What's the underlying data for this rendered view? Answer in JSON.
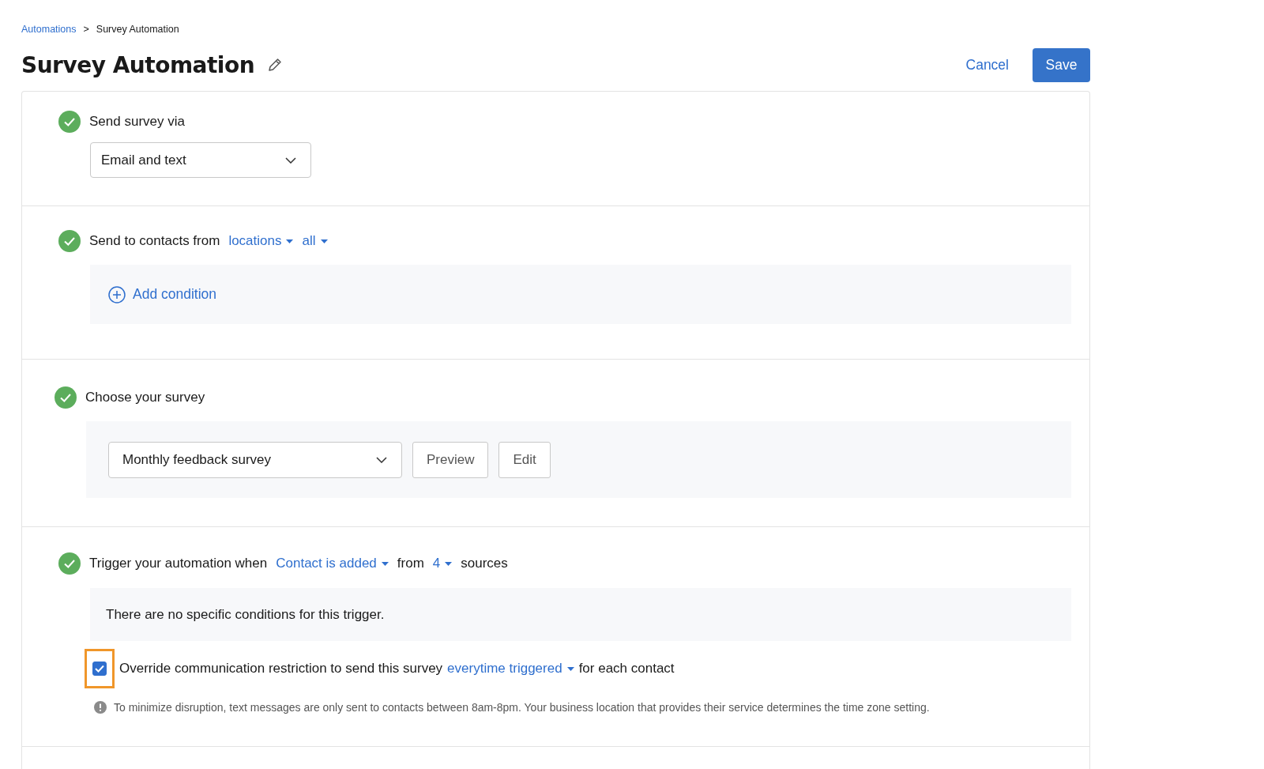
{
  "breadcrumb": [
    {
      "label": "Automations",
      "kind": "link"
    },
    {
      "label": "Survey Automation",
      "kind": "current",
      "separator": ">"
    }
  ],
  "title": "Survey Automation",
  "actions": {
    "cancel": "Cancel",
    "save": "Save"
  },
  "sections": [
    {
      "kind": "select",
      "done": true,
      "header": [
        {
          "kind": "text",
          "text": "Send survey via"
        }
      ],
      "select": {
        "value": "Email and text"
      }
    },
    {
      "kind": "conditions",
      "done": true,
      "header": [
        {
          "kind": "text",
          "text": "Send to contacts from"
        },
        {
          "kind": "dropdown",
          "text": "locations"
        },
        {
          "kind": "dropdown",
          "text": "all"
        }
      ],
      "add_condition": "Add condition"
    },
    {
      "kind": "survey",
      "done": true,
      "header": [
        {
          "kind": "text",
          "text": "Choose your survey"
        }
      ],
      "select": {
        "value": "Monthly feedback survey"
      },
      "buttons": [
        "Preview",
        "Edit"
      ]
    },
    {
      "kind": "trigger",
      "done": true,
      "header": [
        {
          "kind": "text",
          "text": "Trigger your automation when"
        },
        {
          "kind": "dropdown",
          "text": "Contact is added"
        },
        {
          "kind": "text",
          "text": "from"
        },
        {
          "kind": "dropdown",
          "text": "4"
        },
        {
          "kind": "text",
          "text": "sources"
        }
      ],
      "message": "There are no specific conditions for this trigger.",
      "override": {
        "checked": true,
        "highlighted": true,
        "parts": [
          {
            "kind": "text",
            "text": "Override communication restriction to send this survey"
          },
          {
            "kind": "dropdown",
            "text": "everytime triggered"
          },
          {
            "kind": "text",
            "text": "for each contact"
          }
        ]
      },
      "note": "To minimize disruption, text messages are only sent to contacts between 8am-8pm. Your business location that provides their service determines the time zone setting."
    }
  ]
}
